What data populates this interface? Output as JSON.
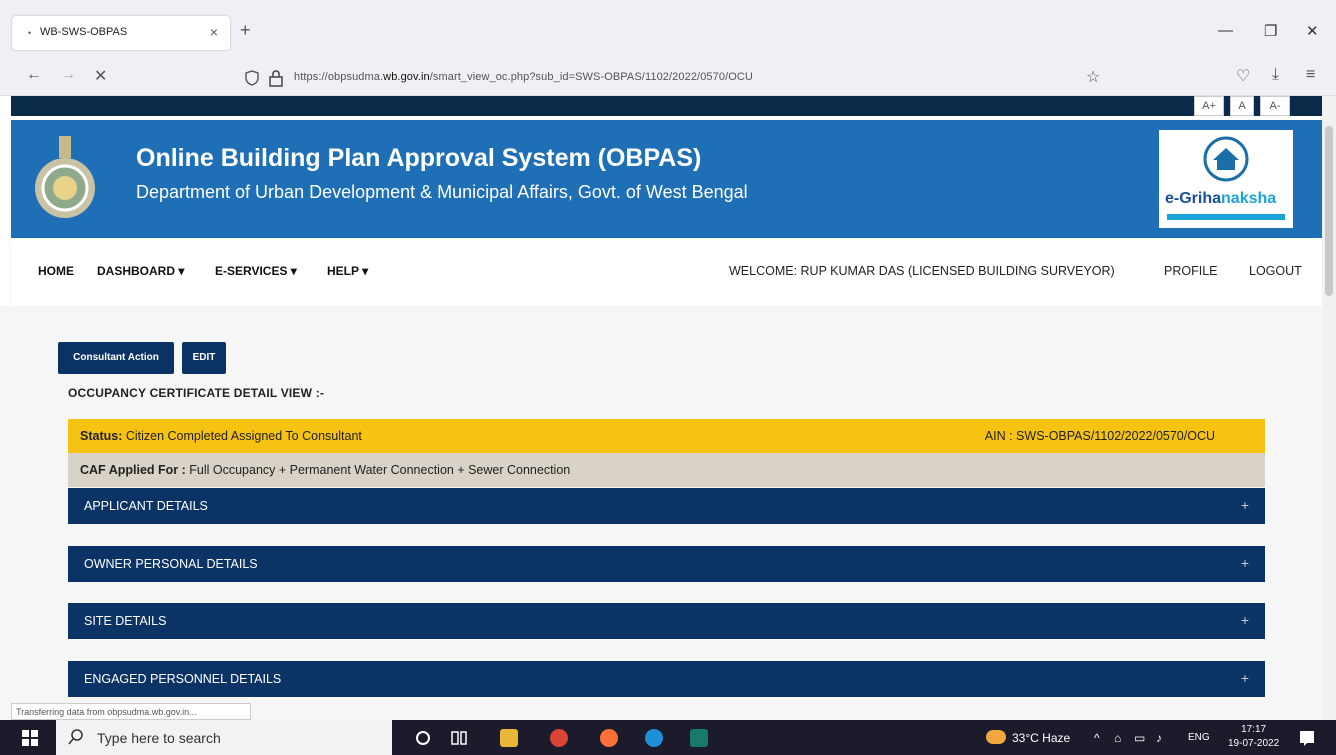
{
  "browser": {
    "tab_title": "WB-SWS-OBPAS",
    "tab_close": "×",
    "new_tab": "+",
    "url_prefix": "https://obpsudma.",
    "url_domain": "wb.gov.in",
    "url_path": "/smart_view_oc.php?sub_id=SWS-OBPAS/1102/2022/0570/OCU",
    "load_status": "Transferring data from obpsudma.wb.gov.in..."
  },
  "font_controls": [
    "A+",
    "A",
    "A-"
  ],
  "header": {
    "title": "Online Building Plan Approval System (OBPAS)",
    "subtitle": "Department of Urban Development & Municipal Affairs, Govt. of West Bengal",
    "logo_text": "e-Grihanaksha"
  },
  "menu": {
    "home": "HOME",
    "dashboard": "DASHBOARD ▾",
    "eservices": "E-SERVICES ▾",
    "help": "HELP ▾",
    "welcome": "WELCOME: RUP KUMAR DAS (LICENSED BUILDING SURVEYOR)",
    "profile": "PROFILE",
    "logout": "LOGOUT"
  },
  "actions": {
    "consultant_action": "Consultant Action",
    "edit": "EDIT"
  },
  "page_title": "OCCUPANCY CERTIFICATE DETAIL VIEW :-",
  "status": {
    "label": "Status:",
    "value": " Citizen Completed Assigned To Consultant",
    "ain": "AIN : SWS-OBPAS/1102/2022/0570/OCU"
  },
  "caf": {
    "label": "CAF Applied For :",
    "value": " Full Occupancy + Permanent Water Connection + Sewer Connection"
  },
  "sections": [
    {
      "title": "APPLICANT DETAILS",
      "toggle": "+"
    },
    {
      "title": "OWNER PERSONAL DETAILS",
      "toggle": "+"
    },
    {
      "title": "SITE DETAILS",
      "toggle": "+"
    },
    {
      "title": "ENGAGED PERSONNEL DETAILS",
      "toggle": "+"
    }
  ],
  "taskbar": {
    "search_placeholder": "Type here to search",
    "weather": "33°C  Haze",
    "language": "ENG",
    "time": "17:17",
    "date": "19-07-2022"
  }
}
